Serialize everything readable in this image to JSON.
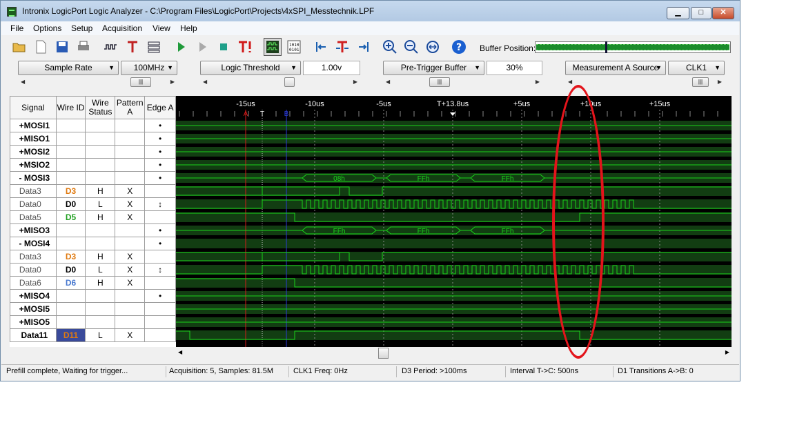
{
  "window": {
    "title": "Intronix LogicPort Logic Analyzer - C:\\Program Files\\LogicPort\\Projects\\4xSPI_Messtechnik.LPF"
  },
  "menu": [
    "File",
    "Options",
    "Setup",
    "Acquisition",
    "View",
    "Help"
  ],
  "toolbar": {
    "buffer_position_label": "Buffer Position:",
    "buffer_position_fraction": 0.36
  },
  "controls": {
    "sample_rate_label": "Sample Rate",
    "sample_rate_value": "100MHz",
    "logic_threshold_label": "Logic Threshold",
    "logic_threshold_value": "1.00v",
    "pretrigger_label": "Pre-Trigger Buffer",
    "pretrigger_value": "30%",
    "measurement_label": "Measurement A Source",
    "measurement_value": "CLK1"
  },
  "table": {
    "headers": [
      "Signal",
      "Wire ID",
      "Wire Status",
      "Pattern A",
      "Edge A"
    ],
    "rows": [
      {
        "signal": "+MOSI1",
        "wire": "",
        "status": "",
        "pattern": "",
        "edge": "•",
        "sub": false
      },
      {
        "signal": "+MISO1",
        "wire": "",
        "status": "",
        "pattern": "",
        "edge": "•",
        "sub": false
      },
      {
        "signal": "+MOSI2",
        "wire": "",
        "status": "",
        "pattern": "",
        "edge": "•",
        "sub": false
      },
      {
        "signal": "+MSIO2",
        "wire": "",
        "status": "",
        "pattern": "",
        "edge": "•",
        "sub": false
      },
      {
        "signal": "- MOSI3",
        "wire": "",
        "status": "",
        "pattern": "",
        "edge": "•",
        "sub": false
      },
      {
        "signal": "Data3",
        "wire": "D3",
        "status": "H",
        "pattern": "X",
        "edge": "",
        "sub": true,
        "color": "#e07a10"
      },
      {
        "signal": "Data0",
        "wire": "D0",
        "status": "L",
        "pattern": "X",
        "edge": "↕",
        "sub": true,
        "color": "#000000"
      },
      {
        "signal": "Data5",
        "wire": "D5",
        "status": "H",
        "pattern": "X",
        "edge": "",
        "sub": true,
        "color": "#22a022"
      },
      {
        "signal": "+MISO3",
        "wire": "",
        "status": "",
        "pattern": "",
        "edge": "•",
        "sub": false
      },
      {
        "signal": "- MOSI4",
        "wire": "",
        "status": "",
        "pattern": "",
        "edge": "•",
        "sub": false
      },
      {
        "signal": "Data3",
        "wire": "D3",
        "status": "H",
        "pattern": "X",
        "edge": "",
        "sub": true,
        "color": "#e07a10"
      },
      {
        "signal": "Data0",
        "wire": "D0",
        "status": "L",
        "pattern": "X",
        "edge": "↕",
        "sub": true,
        "color": "#000000"
      },
      {
        "signal": "Data6",
        "wire": "D6",
        "status": "H",
        "pattern": "X",
        "edge": "",
        "sub": true,
        "color": "#4a7ad0"
      },
      {
        "signal": "+MISO4",
        "wire": "",
        "status": "",
        "pattern": "",
        "edge": "•",
        "sub": false
      },
      {
        "signal": "+MOSI5",
        "wire": "",
        "status": "",
        "pattern": "",
        "edge": "",
        "sub": false
      },
      {
        "signal": "+MISO5",
        "wire": "",
        "status": "",
        "pattern": "",
        "edge": "",
        "sub": false
      },
      {
        "signal": "Data11",
        "wire": "D11",
        "status": "L",
        "pattern": "X",
        "edge": "",
        "sub": false,
        "color": "#e07a10",
        "highlight": true
      }
    ]
  },
  "timeline": {
    "labels": [
      "-15us",
      "-10us",
      "-5us",
      "T+13.8us",
      "+5us",
      "+10us",
      "+15us"
    ],
    "markers": [
      "A",
      "T",
      "B"
    ],
    "bus_labels": {
      "mosi3": [
        "08h",
        "FFh",
        "FFh"
      ],
      "miso3": [
        "FFh",
        "FFh",
        "FFh"
      ]
    }
  },
  "colors": {
    "trace": "#19d419",
    "marker_a": "#d41a1a",
    "marker_b": "#2a3ad8",
    "annotation": "#e3141b"
  },
  "status": {
    "message": "Prefill complete, Waiting for trigger...",
    "acquisition": "Acquisition: 5, Samples: 81.5M",
    "clk_freq": "CLK1 Freq: 0Hz",
    "d3_period": "D3 Period: >100ms",
    "interval": "Interval T->C: 500ns",
    "transitions": "D1 Transitions A->B: 0"
  }
}
